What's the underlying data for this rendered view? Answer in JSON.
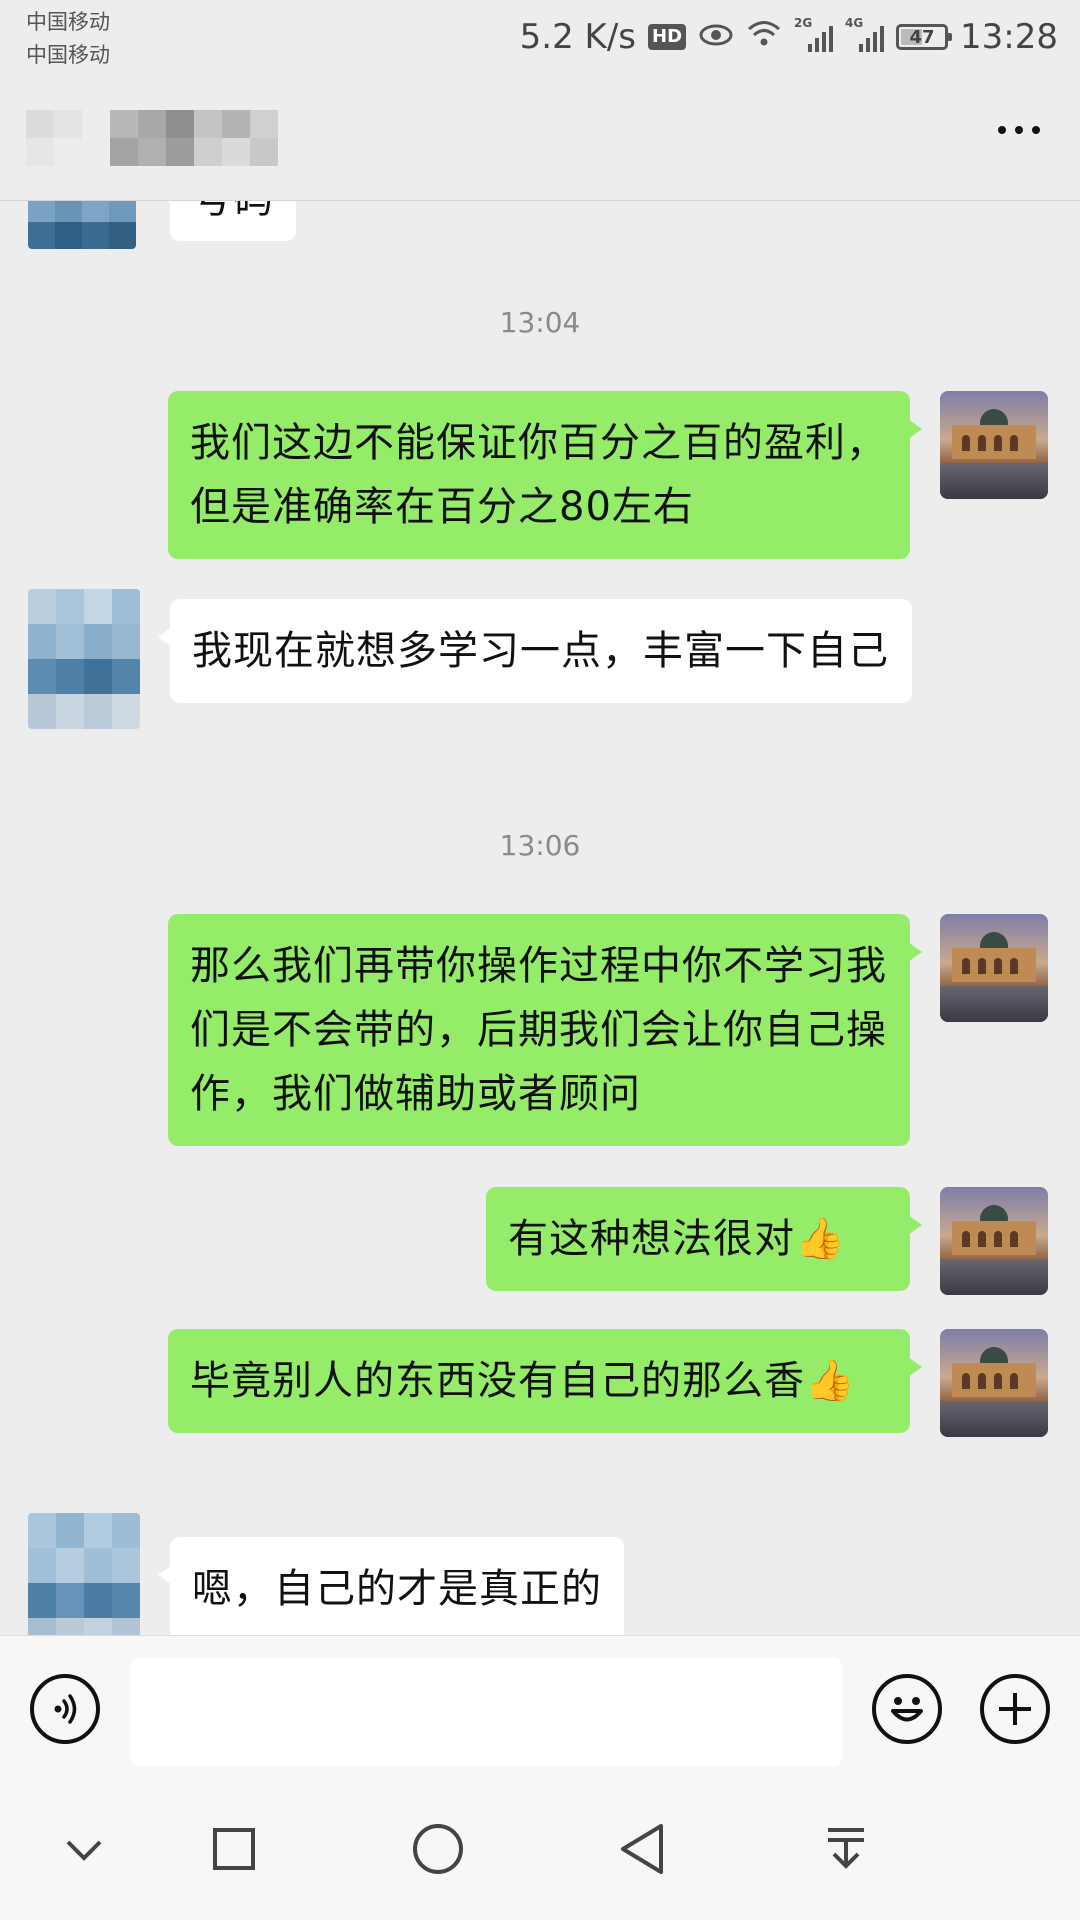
{
  "status_bar": {
    "carrier_1": "中国移动",
    "carrier_2": "中国移动",
    "net_speed": "5.2 K/s",
    "hd_badge": "HD",
    "signal_1_tag": "2G",
    "signal_2_tag": "4G",
    "battery_level": "47",
    "time": "13:28"
  },
  "header": {
    "title": "",
    "more_icon": "more-horizontal-icon"
  },
  "messages": [
    {
      "side": "them",
      "text": "号码",
      "avatar": "pixelated-avatar"
    },
    {
      "type": "time",
      "text": "13:04"
    },
    {
      "side": "me",
      "text": "我们这边不能保证你百分之百的盈利，但是准确率在百分之80左右",
      "avatar": "opera-house-avatar"
    },
    {
      "side": "them",
      "text": "我现在就想多学习一点，丰富一下自己",
      "avatar": "pixelated-avatar"
    },
    {
      "type": "time",
      "text": "13:06"
    },
    {
      "side": "me",
      "text": "那么我们再带你操作过程中你不学习我们是不会带的，后期我们会让你自己操作，我们做辅助或者顾问",
      "avatar": "opera-house-avatar"
    },
    {
      "side": "me",
      "text": "有这种想法很对",
      "emoji": "👍",
      "avatar": "opera-house-avatar"
    },
    {
      "side": "me",
      "text": "毕竟别人的东西没有自己的那么香",
      "emoji": "👍",
      "avatar": "opera-house-avatar"
    },
    {
      "side": "them",
      "text": "嗯，自己的才是真正的",
      "avatar": "pixelated-avatar"
    }
  ],
  "input_bar": {
    "voice_icon": "voice-icon",
    "placeholder": "",
    "emoji_icon": "emoji-smile-icon",
    "add_icon": "add-plus-icon"
  },
  "nav_bar": [
    "chevron-down-icon",
    "recent-apps-square-icon",
    "home-circle-icon",
    "back-triangle-icon",
    "notification-pulldown-icon"
  ],
  "colors": {
    "my_bubble": "#95ec69",
    "their_bubble": "#ffffff",
    "background": "#ededed"
  }
}
